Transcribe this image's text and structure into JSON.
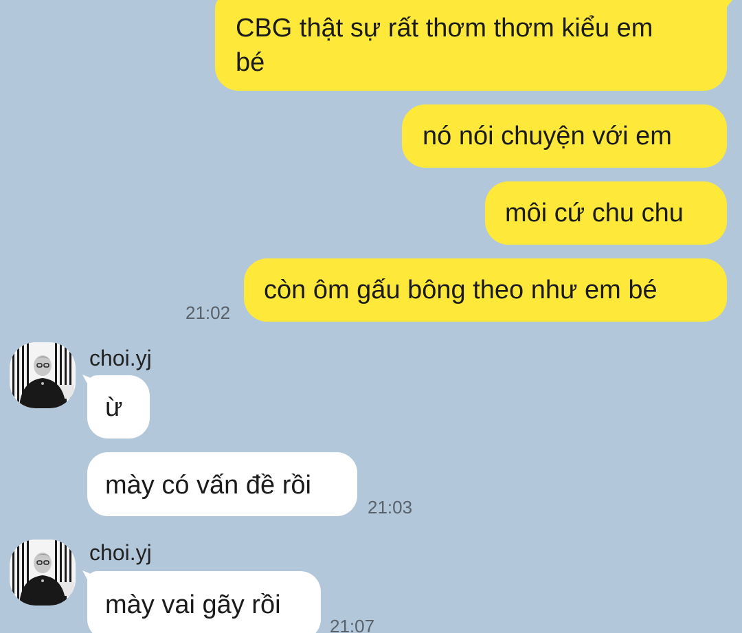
{
  "chat": {
    "messages_out": [
      {
        "lines": [
          "CBG thật sự rất thơm thơm kiểu em",
          "bé"
        ]
      },
      {
        "text": "nó nói chuyện với em"
      },
      {
        "text": "môi cứ chu chu"
      },
      {
        "text": "còn ôm gấu bông theo như em bé"
      }
    ],
    "time_out": "21:02",
    "group1": {
      "sender": "choi.yj",
      "messages": [
        "ừ",
        "mày có vấn đề rồi"
      ],
      "time": "21:03"
    },
    "group2": {
      "sender": "choi.yj",
      "messages": [
        "mày vai gãy rồi"
      ],
      "time": "21:07"
    }
  },
  "colors": {
    "background": "#b2c7da",
    "outgoing_bubble": "#fee93a",
    "incoming_bubble": "#ffffff"
  },
  "icons": {
    "avatar": "profile-photo-avatar"
  }
}
